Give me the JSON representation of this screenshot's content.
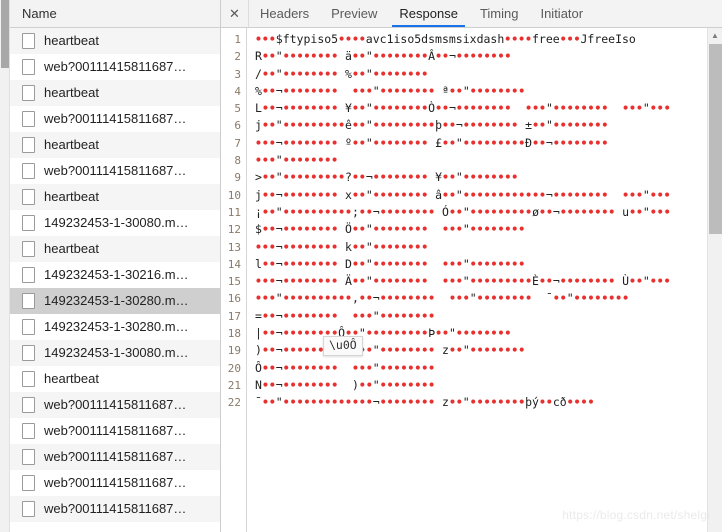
{
  "left_panel": {
    "header": {
      "label": "Name"
    },
    "rows": [
      {
        "label": "heartbeat",
        "selected": false
      },
      {
        "label": "web?00111415811687…",
        "selected": false
      },
      {
        "label": "heartbeat",
        "selected": false
      },
      {
        "label": "web?00111415811687…",
        "selected": false
      },
      {
        "label": "heartbeat",
        "selected": false
      },
      {
        "label": "web?00111415811687…",
        "selected": false
      },
      {
        "label": "heartbeat",
        "selected": false
      },
      {
        "label": "149232453-1-30080.m…",
        "selected": false
      },
      {
        "label": "heartbeat",
        "selected": false
      },
      {
        "label": "149232453-1-30216.m…",
        "selected": false
      },
      {
        "label": "149232453-1-30280.m…",
        "selected": true
      },
      {
        "label": "149232453-1-30280.m…",
        "selected": false
      },
      {
        "label": "149232453-1-30080.m…",
        "selected": false
      },
      {
        "label": "heartbeat",
        "selected": false
      },
      {
        "label": "web?00111415811687…",
        "selected": false
      },
      {
        "label": "web?00111415811687…",
        "selected": false
      },
      {
        "label": "web?00111415811687…",
        "selected": false
      },
      {
        "label": "web?00111415811687…",
        "selected": false
      },
      {
        "label": "web?00111415811687…",
        "selected": false
      }
    ]
  },
  "right_panel": {
    "close_label": "✕",
    "tabs": [
      {
        "label": "Headers",
        "active": false
      },
      {
        "label": "Preview",
        "active": false
      },
      {
        "label": "Response",
        "active": true
      },
      {
        "label": "Timing",
        "active": false
      },
      {
        "label": "Initiator",
        "active": false
      }
    ],
    "active_tab": "Response",
    "accent_color": "#1a73e8"
  },
  "response": {
    "line_numbers": [
      1,
      2,
      3,
      4,
      5,
      6,
      7,
      8,
      9,
      10,
      11,
      12,
      13,
      14,
      15,
      16,
      17,
      18,
      19,
      20,
      21,
      22
    ],
    "dot_color": "#e8312f",
    "lines": [
      [
        {
          "t": "d",
          "v": "•••"
        },
        {
          "t": "t",
          "v": "$ftypiso5"
        },
        {
          "t": "d",
          "v": "••••"
        },
        {
          "t": "t",
          "v": "avc1iso5dsmsmsixdash"
        },
        {
          "t": "d",
          "v": "••••"
        },
        {
          "t": "t",
          "v": "free"
        },
        {
          "t": "d",
          "v": "•••"
        },
        {
          "t": "t",
          "v": "JfreeIso"
        }
      ],
      [
        {
          "t": "t",
          "v": "R"
        },
        {
          "t": "d",
          "v": "••"
        },
        {
          "t": "t",
          "v": "\""
        },
        {
          "t": "d",
          "v": "••••••••"
        },
        {
          "t": "t",
          "v": " ä"
        },
        {
          "t": "d",
          "v": "••"
        },
        {
          "t": "t",
          "v": "\""
        },
        {
          "t": "d",
          "v": "••••••••"
        },
        {
          "t": "t",
          "v": "Â"
        },
        {
          "t": "d",
          "v": "••"
        },
        {
          "t": "t",
          "v": "¬"
        },
        {
          "t": "d",
          "v": "••••••••"
        }
      ],
      [
        {
          "t": "t",
          "v": "/"
        },
        {
          "t": "d",
          "v": "••"
        },
        {
          "t": "t",
          "v": "\""
        },
        {
          "t": "d",
          "v": "••••••••"
        },
        {
          "t": "t",
          "v": " %"
        },
        {
          "t": "d",
          "v": "••"
        },
        {
          "t": "t",
          "v": "\""
        },
        {
          "t": "d",
          "v": "••••••••"
        }
      ],
      [
        {
          "t": "t",
          "v": "%"
        },
        {
          "t": "d",
          "v": "••"
        },
        {
          "t": "t",
          "v": "¬"
        },
        {
          "t": "d",
          "v": "••••••••"
        },
        {
          "t": "t",
          "v": "  "
        },
        {
          "t": "d",
          "v": "•••"
        },
        {
          "t": "t",
          "v": "\""
        },
        {
          "t": "d",
          "v": "••••••••"
        },
        {
          "t": "t",
          "v": " ª"
        },
        {
          "t": "d",
          "v": "••"
        },
        {
          "t": "t",
          "v": "\""
        },
        {
          "t": "d",
          "v": "••••••••"
        }
      ],
      [
        {
          "t": "t",
          "v": "L"
        },
        {
          "t": "d",
          "v": "••"
        },
        {
          "t": "t",
          "v": "¬"
        },
        {
          "t": "d",
          "v": "••••••••"
        },
        {
          "t": "t",
          "v": " ¥"
        },
        {
          "t": "d",
          "v": "••"
        },
        {
          "t": "t",
          "v": "\""
        },
        {
          "t": "d",
          "v": "••••••••"
        },
        {
          "t": "t",
          "v": "Ò"
        },
        {
          "t": "d",
          "v": "••"
        },
        {
          "t": "t",
          "v": "¬"
        },
        {
          "t": "d",
          "v": "••••••••"
        },
        {
          "t": "t",
          "v": "  "
        },
        {
          "t": "d",
          "v": "•••"
        },
        {
          "t": "t",
          "v": "\""
        },
        {
          "t": "d",
          "v": "••••••••"
        },
        {
          "t": "t",
          "v": "  "
        },
        {
          "t": "d",
          "v": "•••"
        },
        {
          "t": "t",
          "v": "\""
        },
        {
          "t": "d",
          "v": "•••"
        }
      ],
      [
        {
          "t": "t",
          "v": "j"
        },
        {
          "t": "d",
          "v": "••"
        },
        {
          "t": "t",
          "v": "\""
        },
        {
          "t": "d",
          "v": "•••••••••"
        },
        {
          "t": "t",
          "v": "ê"
        },
        {
          "t": "d",
          "v": "••"
        },
        {
          "t": "t",
          "v": "\""
        },
        {
          "t": "d",
          "v": "•••••••••"
        },
        {
          "t": "t",
          "v": "þ"
        },
        {
          "t": "d",
          "v": "••"
        },
        {
          "t": "t",
          "v": "¬"
        },
        {
          "t": "d",
          "v": "••••••••"
        },
        {
          "t": "t",
          "v": " ±"
        },
        {
          "t": "d",
          "v": "••"
        },
        {
          "t": "t",
          "v": "\""
        },
        {
          "t": "d",
          "v": "••••••••"
        }
      ],
      [
        {
          "t": "d",
          "v": "•••"
        },
        {
          "t": "t",
          "v": "¬"
        },
        {
          "t": "d",
          "v": "••••••••"
        },
        {
          "t": "t",
          "v": " º"
        },
        {
          "t": "d",
          "v": "••"
        },
        {
          "t": "t",
          "v": "\""
        },
        {
          "t": "d",
          "v": "••••••••"
        },
        {
          "t": "t",
          "v": " £"
        },
        {
          "t": "d",
          "v": "••"
        },
        {
          "t": "t",
          "v": "\""
        },
        {
          "t": "d",
          "v": "•••••••••"
        },
        {
          "t": "t",
          "v": "Ð"
        },
        {
          "t": "d",
          "v": "••"
        },
        {
          "t": "t",
          "v": "¬"
        },
        {
          "t": "d",
          "v": "••••••••"
        }
      ],
      [
        {
          "t": "d",
          "v": "•••"
        },
        {
          "t": "t",
          "v": "\""
        },
        {
          "t": "d",
          "v": "••••••••"
        }
      ],
      [
        {
          "t": "t",
          "v": ">"
        },
        {
          "t": "d",
          "v": "••"
        },
        {
          "t": "t",
          "v": "\""
        },
        {
          "t": "d",
          "v": "•••••••••"
        },
        {
          "t": "t",
          "v": "?"
        },
        {
          "t": "d",
          "v": "••"
        },
        {
          "t": "t",
          "v": "¬"
        },
        {
          "t": "d",
          "v": "••••••••"
        },
        {
          "t": "t",
          "v": " ¥"
        },
        {
          "t": "d",
          "v": "••"
        },
        {
          "t": "t",
          "v": "\""
        },
        {
          "t": "d",
          "v": "••••••••"
        }
      ],
      [
        {
          "t": "t",
          "v": "j"
        },
        {
          "t": "d",
          "v": "••"
        },
        {
          "t": "t",
          "v": "¬"
        },
        {
          "t": "d",
          "v": "••••••••"
        },
        {
          "t": "t",
          "v": " x"
        },
        {
          "t": "d",
          "v": "••"
        },
        {
          "t": "t",
          "v": "\""
        },
        {
          "t": "d",
          "v": "••••••••"
        },
        {
          "t": "t",
          "v": " â"
        },
        {
          "t": "d",
          "v": "••"
        },
        {
          "t": "t",
          "v": "\""
        },
        {
          "t": "d",
          "v": "••••••••••••"
        },
        {
          "t": "t",
          "v": "¬"
        },
        {
          "t": "d",
          "v": "••••••••"
        },
        {
          "t": "t",
          "v": "  "
        },
        {
          "t": "d",
          "v": "•••"
        },
        {
          "t": "t",
          "v": "\""
        },
        {
          "t": "d",
          "v": "•••"
        }
      ],
      [
        {
          "t": "t",
          "v": "¡"
        },
        {
          "t": "d",
          "v": "••"
        },
        {
          "t": "t",
          "v": "\""
        },
        {
          "t": "d",
          "v": "••••••••••"
        },
        {
          "t": "t",
          "v": ";"
        },
        {
          "t": "d",
          "v": "••"
        },
        {
          "t": "t",
          "v": "¬"
        },
        {
          "t": "d",
          "v": "••••••••"
        },
        {
          "t": "t",
          "v": " Ó"
        },
        {
          "t": "d",
          "v": "••"
        },
        {
          "t": "t",
          "v": "\""
        },
        {
          "t": "d",
          "v": "•••••••••"
        },
        {
          "t": "t",
          "v": "ø"
        },
        {
          "t": "d",
          "v": "••"
        },
        {
          "t": "t",
          "v": "¬"
        },
        {
          "t": "d",
          "v": "••••••••"
        },
        {
          "t": "t",
          "v": " u"
        },
        {
          "t": "d",
          "v": "••"
        },
        {
          "t": "t",
          "v": "\""
        },
        {
          "t": "d",
          "v": "•••"
        }
      ],
      [
        {
          "t": "t",
          "v": "$"
        },
        {
          "t": "d",
          "v": "••"
        },
        {
          "t": "t",
          "v": "¬"
        },
        {
          "t": "d",
          "v": "••••••••"
        },
        {
          "t": "t",
          "v": " Ö"
        },
        {
          "t": "d",
          "v": "••"
        },
        {
          "t": "t",
          "v": "\""
        },
        {
          "t": "d",
          "v": "••••••••"
        },
        {
          "t": "t",
          "v": "  "
        },
        {
          "t": "d",
          "v": "•••"
        },
        {
          "t": "t",
          "v": "\""
        },
        {
          "t": "d",
          "v": "••••••••"
        }
      ],
      [
        {
          "t": "d",
          "v": "•••"
        },
        {
          "t": "t",
          "v": "¬"
        },
        {
          "t": "d",
          "v": "••••••••"
        },
        {
          "t": "t",
          "v": " k"
        },
        {
          "t": "d",
          "v": "••"
        },
        {
          "t": "t",
          "v": "\""
        },
        {
          "t": "d",
          "v": "••••••••"
        }
      ],
      [
        {
          "t": "t",
          "v": "l"
        },
        {
          "t": "d",
          "v": "••"
        },
        {
          "t": "t",
          "v": "¬"
        },
        {
          "t": "d",
          "v": "••••••••"
        },
        {
          "t": "t",
          "v": " D"
        },
        {
          "t": "d",
          "v": "••"
        },
        {
          "t": "t",
          "v": "\""
        },
        {
          "t": "d",
          "v": "••••••••"
        },
        {
          "t": "t",
          "v": "  "
        },
        {
          "t": "d",
          "v": "•••"
        },
        {
          "t": "t",
          "v": "\""
        },
        {
          "t": "d",
          "v": "••••••••"
        }
      ],
      [
        {
          "t": "d",
          "v": "•••"
        },
        {
          "t": "t",
          "v": "¬"
        },
        {
          "t": "d",
          "v": "••••••••"
        },
        {
          "t": "t",
          "v": " Ä"
        },
        {
          "t": "d",
          "v": "••"
        },
        {
          "t": "t",
          "v": "\""
        },
        {
          "t": "d",
          "v": "••••••••"
        },
        {
          "t": "t",
          "v": "  "
        },
        {
          "t": "d",
          "v": "•••"
        },
        {
          "t": "t",
          "v": "\""
        },
        {
          "t": "d",
          "v": "•••••••••"
        },
        {
          "t": "t",
          "v": "È"
        },
        {
          "t": "d",
          "v": "••"
        },
        {
          "t": "t",
          "v": "¬"
        },
        {
          "t": "d",
          "v": "••••••••"
        },
        {
          "t": "t",
          "v": " Ù"
        },
        {
          "t": "d",
          "v": "••"
        },
        {
          "t": "t",
          "v": "\""
        },
        {
          "t": "d",
          "v": "•••"
        }
      ],
      [
        {
          "t": "d",
          "v": "•••"
        },
        {
          "t": "t",
          "v": "\""
        },
        {
          "t": "d",
          "v": "••••••••••"
        },
        {
          "t": "t",
          "v": ","
        },
        {
          "t": "d",
          "v": "••"
        },
        {
          "t": "t",
          "v": "¬"
        },
        {
          "t": "d",
          "v": "••••••••"
        },
        {
          "t": "t",
          "v": "  "
        },
        {
          "t": "d",
          "v": "•••"
        },
        {
          "t": "t",
          "v": "\""
        },
        {
          "t": "d",
          "v": "••••••••"
        },
        {
          "t": "t",
          "v": "  ¯"
        },
        {
          "t": "d",
          "v": "••"
        },
        {
          "t": "t",
          "v": "\""
        },
        {
          "t": "d",
          "v": "••••••••"
        }
      ],
      [
        {
          "t": "t",
          "v": "="
        },
        {
          "t": "d",
          "v": "••"
        },
        {
          "t": "t",
          "v": "¬"
        },
        {
          "t": "d",
          "v": "••••••••"
        },
        {
          "t": "t",
          "v": "  "
        },
        {
          "t": "d",
          "v": "•••"
        },
        {
          "t": "t",
          "v": "\""
        },
        {
          "t": "d",
          "v": "••••••••"
        }
      ],
      [
        {
          "t": "t",
          "v": "|"
        },
        {
          "t": "d",
          "v": "••"
        },
        {
          "t": "t",
          "v": "¬"
        },
        {
          "t": "d",
          "v": "••••••••"
        },
        {
          "t": "t",
          "v": "Ô"
        },
        {
          "t": "d",
          "v": "••"
        },
        {
          "t": "t",
          "v": "\""
        },
        {
          "t": "d",
          "v": "•••••••••"
        },
        {
          "t": "t",
          "v": "Þ"
        },
        {
          "t": "d",
          "v": "••"
        },
        {
          "t": "t",
          "v": "\""
        },
        {
          "t": "d",
          "v": "••••••••"
        }
      ],
      [
        {
          "t": "t",
          "v": ")"
        },
        {
          "t": "d",
          "v": "••"
        },
        {
          "t": "t",
          "v": "¬"
        },
        {
          "t": "d",
          "v": "•••••••••"
        },
        {
          "t": "t",
          "v": " "
        },
        {
          "t": "d",
          "v": "•••"
        },
        {
          "t": "t",
          "v": "\""
        },
        {
          "t": "d",
          "v": "••••••••"
        },
        {
          "t": "t",
          "v": " z"
        },
        {
          "t": "d",
          "v": "••"
        },
        {
          "t": "t",
          "v": "\""
        },
        {
          "t": "d",
          "v": "••••••••"
        }
      ],
      [
        {
          "t": "t",
          "v": "Ô"
        },
        {
          "t": "d",
          "v": "••"
        },
        {
          "t": "t",
          "v": "¬"
        },
        {
          "t": "d",
          "v": "••••••••"
        },
        {
          "t": "t",
          "v": "  "
        },
        {
          "t": "d",
          "v": "•••"
        },
        {
          "t": "t",
          "v": "\""
        },
        {
          "t": "d",
          "v": "••••••••"
        }
      ],
      [
        {
          "t": "t",
          "v": "N"
        },
        {
          "t": "d",
          "v": "••"
        },
        {
          "t": "t",
          "v": "¬"
        },
        {
          "t": "d",
          "v": "••••••••"
        },
        {
          "t": "t",
          "v": "  )"
        },
        {
          "t": "d",
          "v": "••"
        },
        {
          "t": "t",
          "v": "\""
        },
        {
          "t": "d",
          "v": "••••••••"
        }
      ],
      [
        {
          "t": "t",
          "v": "¯"
        },
        {
          "t": "d",
          "v": "••"
        },
        {
          "t": "t",
          "v": "\""
        },
        {
          "t": "d",
          "v": "•••••••••••••"
        },
        {
          "t": "t",
          "v": "¬"
        },
        {
          "t": "d",
          "v": "••••••••"
        },
        {
          "t": "t",
          "v": " z"
        },
        {
          "t": "d",
          "v": "••"
        },
        {
          "t": "t",
          "v": "\""
        },
        {
          "t": "d",
          "v": "••••••••"
        },
        {
          "t": "t",
          "v": "þý"
        },
        {
          "t": "d",
          "v": "••"
        },
        {
          "t": "t",
          "v": "cð"
        },
        {
          "t": "d",
          "v": "••••"
        }
      ]
    ]
  },
  "tooltip": {
    "text": "\\u0Ô"
  },
  "watermark": {
    "text": "https://blog.csdn.net/shelgi"
  }
}
